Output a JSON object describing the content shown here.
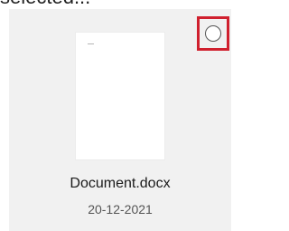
{
  "partial_label": "selected...",
  "file": {
    "name": "Document.docx",
    "date": "20-12-2021",
    "thumbnail": "word-document-page"
  },
  "selection": {
    "selected": false,
    "icon": "circle-checkbox-icon",
    "highlight_color": "#d0202e"
  },
  "colors": {
    "tile_background": "#f1f1f1",
    "highlight": "#d0202e"
  }
}
